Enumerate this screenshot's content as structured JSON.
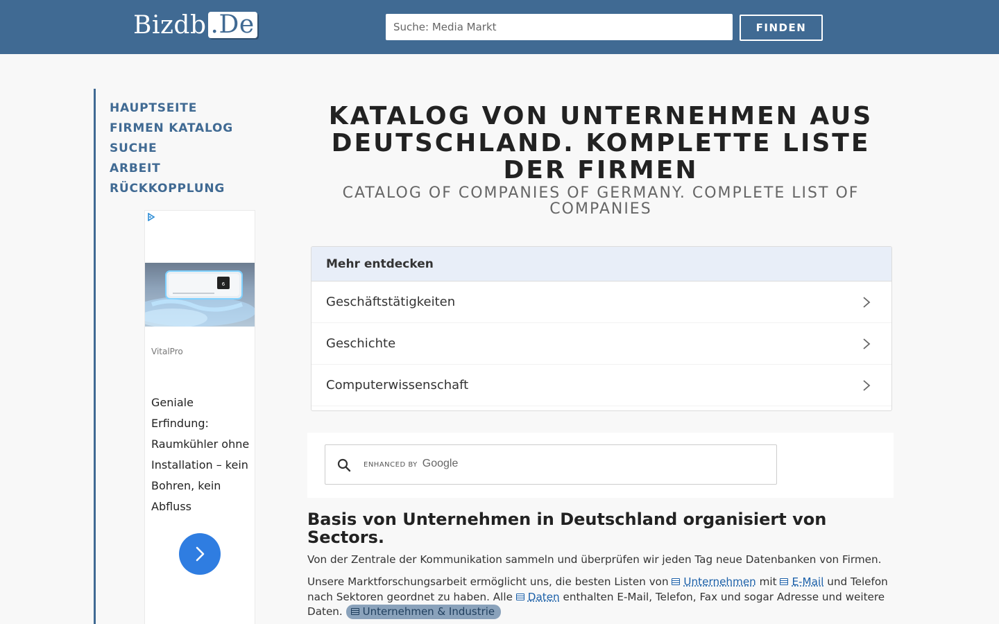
{
  "header": {
    "logo_main": "Bizdb",
    "logo_suffix": ".De",
    "search_placeholder": "Suche: Media Markt",
    "find_label": "FINDEN"
  },
  "sidebar": {
    "nav": [
      "HAUPTSEITE",
      "FIRMEN KATALOG",
      "SUCHE",
      "ARBEIT",
      "RÜCKKOPPLUNG"
    ]
  },
  "ad": {
    "brand": "VitalPro",
    "text": "Geniale Erfindung: Raumkühler ohne Installation – kein Bohren, kein Abfluss"
  },
  "main": {
    "title": "KATALOG VON UNTERNEHMEN AUS DEUTSCHLAND. KOMPLETTE LISTE DER FIRMEN",
    "subtitle": "CATALOG OF COMPANIES OF GERMANY. COMPLETE LIST OF COMPANIES",
    "discover": {
      "heading": "Mehr entdecken",
      "items": [
        "Geschäftstätigkeiten",
        "Geschichte",
        "Computerwissenschaft"
      ]
    },
    "google_search": {
      "enhanced_by": "ENHANCED BY",
      "google": "Google"
    },
    "section_title": "Basis von Unternehmen in Deutschland organisiert von Sectors.",
    "paragraph1": "Von der Zentrale der Kommunikation sammeln und überprüfen wir jeden Tag neue Datenbanken von Firmen.",
    "paragraph2": {
      "part1": "Unsere Marktforschungsarbeit ermöglicht uns, die besten Listen von ",
      "link1": "Unternehmen",
      "part2": " mit ",
      "link2": "E-Mail",
      "part3": " und Telefon nach Sektoren geordnet zu haben. Alle ",
      "link3": "Daten",
      "part4": " enthalten E-Mail, Telefon, Fax und sogar Adresse und weitere Daten. ",
      "tag": "Unternehmen & Industrie"
    }
  }
}
